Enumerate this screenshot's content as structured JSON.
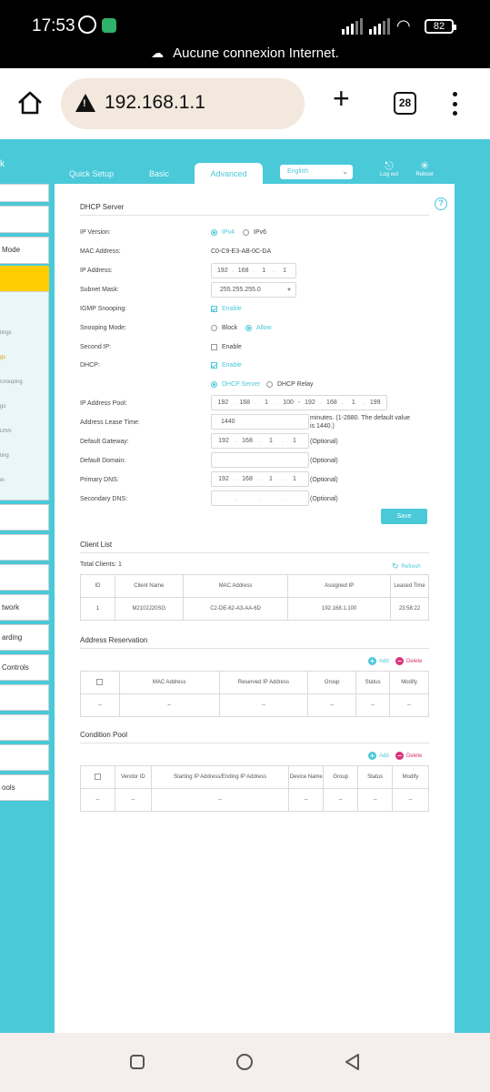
{
  "status_bar": {
    "time": "17:53",
    "battery": "82",
    "network_notice": "Aucune connexion Internet."
  },
  "browser": {
    "url": "192.168.1.1",
    "tab_count": "28"
  },
  "nav": {
    "quick_setup": "Quick Setup",
    "basic": "Basic",
    "advanced": "Advanced",
    "language": "English",
    "logout": "Log out",
    "reboot": "Reboot",
    "partial_k": "k"
  },
  "sidebar": {
    "items": [
      " Mode",
      "twork",
      "arding",
      " Controls",
      "ools"
    ],
    "subitems": [
      "tings",
      "gs",
      "Grouping",
      "gs",
      "DNS",
      "ting",
      "el"
    ]
  },
  "dhcp_server": {
    "title": "DHCP Server",
    "ip_version_label": "IP Version:",
    "ipv4": "IPv4",
    "ipv6": "IPv6",
    "mac_label": "MAC Address:",
    "mac_value": "C0-C9-E3-AB-0C-DA",
    "ip_label": "IP Address:",
    "ip_value": [
      "192",
      "168",
      "1",
      "1"
    ],
    "subnet_label": "Subnet Mask:",
    "subnet_value": "255.255.255.0",
    "igmp_label": "IGMP Snooping:",
    "igmp_enable": "Enable",
    "snoop_mode_label": "Snooping Mode:",
    "block": "Block",
    "allow": "Allow",
    "second_ip_label": "Second IP:",
    "second_ip_enable": "Enable",
    "dhcp_label": "DHCP:",
    "dhcp_enable": "Enable",
    "dhcp_server_opt": "DHCP Server",
    "dhcp_relay_opt": "DHCP Relay",
    "pool_label": "IP Address Pool:",
    "pool_start": [
      "192",
      "168",
      "1",
      "100"
    ],
    "pool_end": [
      "192",
      "168",
      "1",
      "199"
    ],
    "lease_label": "Address Lease Time:",
    "lease_value": "1440",
    "lease_hint": "minutes. (1-2880. The default value is 1440.)",
    "gateway_label": "Default Gateway:",
    "gateway_value": [
      "192",
      "168",
      "1",
      "1"
    ],
    "optional": "(Optional)",
    "domain_label": "Default Domain:",
    "primary_dns_label": "Primary DNS:",
    "primary_dns_value": [
      "192",
      "168",
      "1",
      "1"
    ],
    "secondary_dns_label": "Secondary DNS:",
    "save": "Save"
  },
  "client_list": {
    "title": "Client List",
    "total": "Total Clients: 1",
    "refresh": "Refresh",
    "headers": [
      "ID",
      "Client Name",
      "MAC Address",
      "Assigned IP",
      "Leased Time"
    ],
    "rows": [
      [
        "1",
        "M2102J20SG",
        "C2-DE-62-A3-AA-6D",
        "192.168.1.100",
        "23:58:22"
      ]
    ]
  },
  "address_reservation": {
    "title": "Address Reservation",
    "add": "Add",
    "delete": "Delete",
    "headers": [
      "MAC Address",
      "Reserved IP Address",
      "Group",
      "Status",
      "Modify"
    ],
    "empty": "--"
  },
  "condition_pool": {
    "title": "Condition Pool",
    "add": "Add",
    "delete": "Delete",
    "headers": [
      "Vendor ID",
      "Starting IP Address/Ending IP Address",
      "Device Name",
      "Group",
      "Status",
      "Modify"
    ],
    "empty": "--"
  },
  "colors": {
    "accent": "#4AC9D9",
    "highlight": "#FFCD00",
    "delete": "#D9337A"
  }
}
